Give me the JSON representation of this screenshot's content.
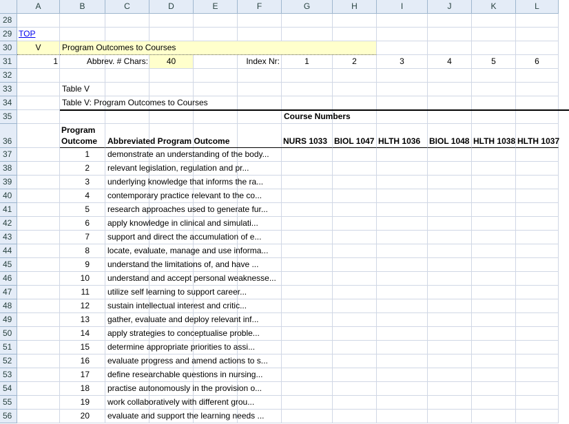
{
  "columns": [
    "A",
    "B",
    "C",
    "D",
    "E",
    "F",
    "G",
    "H",
    "I",
    "J",
    "K",
    "L"
  ],
  "row_numbers": [
    "28",
    "29",
    "30",
    "31",
    "32",
    "33",
    "34",
    "35",
    "36",
    "37",
    "38",
    "39",
    "40",
    "41",
    "42",
    "43",
    "44",
    "45",
    "46",
    "47",
    "48",
    "49",
    "50",
    "51",
    "52",
    "53",
    "54",
    "55",
    "56"
  ],
  "top_link": "TOP",
  "section_letter": "V",
  "section_title": "Program Outcomes to Courses",
  "row31": {
    "a": "1",
    "abbrev_label": "Abbrev. # Chars:",
    "abbrev_value": "40",
    "index_label": "Index Nr:",
    "index_values": [
      "1",
      "2",
      "3",
      "4",
      "5",
      "6"
    ]
  },
  "table_label": "Table V",
  "table_caption": "Table V: Program Outcomes to Courses",
  "course_numbers_label": "Course Numbers",
  "header": {
    "program_outcome_line1": "Program",
    "program_outcome_line2": "Outcome",
    "abbreviated": "Abbreviated Program Outcome",
    "courses": [
      "NURS 1033",
      "BIOL 1047",
      "HLTH 1036",
      "BIOL 1048",
      "HLTH 1038",
      "HLTH 1037"
    ]
  },
  "outcomes": [
    {
      "n": "1",
      "text": "demonstrate an understanding of the body..."
    },
    {
      "n": "2",
      "text": "relevant  legislation, regulation and pr..."
    },
    {
      "n": "3",
      "text": "underlying knowledge that informs the ra..."
    },
    {
      "n": "4",
      "text": "contemporary practice relevant to the co..."
    },
    {
      "n": "5",
      "text": "research approaches used to generate fur..."
    },
    {
      "n": "6",
      "text": "apply knowledge in clinical and simulati..."
    },
    {
      "n": "7",
      "text": "support and direct the accumulation of e..."
    },
    {
      "n": "8",
      "text": "locate, evaluate, manage and use informa..."
    },
    {
      "n": "9",
      "text": "understand the limitations of, and have ..."
    },
    {
      "n": "10",
      "text": "understand and accept personal weaknesse..."
    },
    {
      "n": "11",
      "text": "utilize self learning  to support career..."
    },
    {
      "n": "12",
      "text": "sustain intellectual interest and critic..."
    },
    {
      "n": "13",
      "text": "gather, evaluate and deploy relevant inf..."
    },
    {
      "n": "14",
      "text": "apply strategies to conceptualise proble..."
    },
    {
      "n": "15",
      "text": "determine appropriate priorities to assi..."
    },
    {
      "n": "16",
      "text": "evaluate progress and amend actions to s..."
    },
    {
      "n": "17",
      "text": "define researchable questions in nursing..."
    },
    {
      "n": "18",
      "text": "practise autonomously in the provision o..."
    },
    {
      "n": "19",
      "text": "work collaboratively with different grou..."
    },
    {
      "n": "20",
      "text": "evaluate and support the learning needs ..."
    }
  ]
}
